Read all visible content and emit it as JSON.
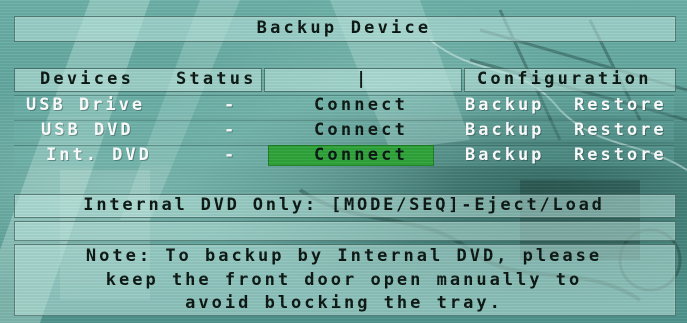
{
  "title": "Backup Device",
  "columns": {
    "devices": "Devices",
    "status": "Status",
    "separator": "|",
    "configuration": "Configuration"
  },
  "rows": [
    {
      "device": "USB Drive",
      "status": "-",
      "connect": "Connect",
      "backup": "Backup",
      "restore": "Restore",
      "selected": false
    },
    {
      "device": "USB DVD",
      "status": "-",
      "connect": "Connect",
      "backup": "Backup",
      "restore": "Restore",
      "selected": false
    },
    {
      "device": "Int. DVD",
      "status": "-",
      "connect": "Connect",
      "backup": "Backup",
      "restore": "Restore",
      "selected": true
    }
  ],
  "internal_dvd_hint": "Internal DVD Only: [MODE/SEQ]-Eject/Load",
  "note_lines": [
    "Note: To backup by Internal DVD, please",
    "keep the front door open manually to",
    "avoid blocking the tray."
  ],
  "colors": {
    "highlight": "#2fa33a",
    "bar_fill": "#bee8e0",
    "text_dark": "#0b1612",
    "text_light": "#ffffff"
  }
}
